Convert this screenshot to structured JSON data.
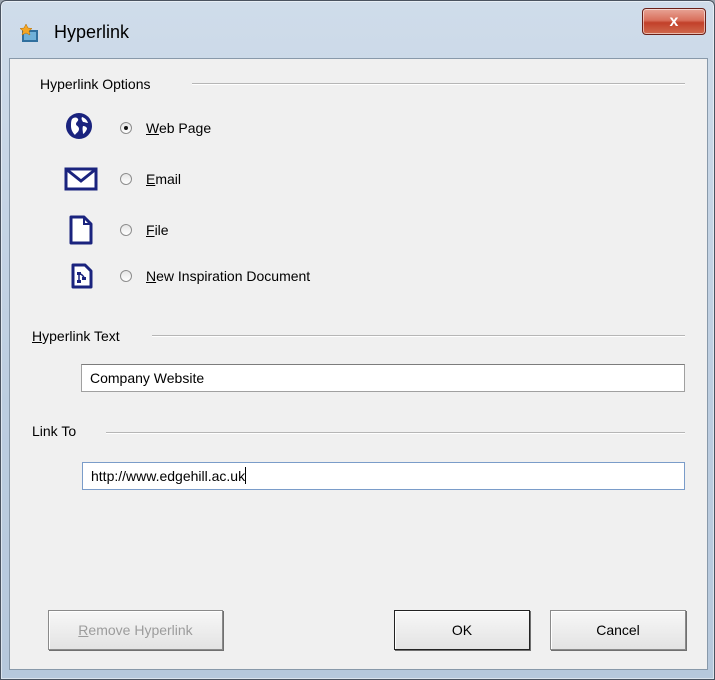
{
  "window": {
    "title": "Hyperlink",
    "close_glyph": "x"
  },
  "options_group": {
    "title": "Hyperlink Options",
    "options": [
      {
        "mnemonic": "W",
        "rest": "eb Page",
        "icon": "globe-icon",
        "checked": true
      },
      {
        "mnemonic": "E",
        "rest": "mail",
        "icon": "envelope-icon",
        "checked": false
      },
      {
        "mnemonic": "F",
        "rest": "ile",
        "icon": "document-icon",
        "checked": false
      },
      {
        "mnemonic": "N",
        "rest": "ew Inspiration Document",
        "icon": "inspiration-document-icon",
        "checked": false
      }
    ]
  },
  "hyperlink_text": {
    "label_mnemonic": "H",
    "label_rest": "yperlink Text",
    "value": "Company Website"
  },
  "link_to": {
    "label": "Link To",
    "value": "http://www.edgehill.ac.uk"
  },
  "buttons": {
    "remove_mnemonic": "R",
    "remove_rest": "emove Hyperlink",
    "ok": "OK",
    "cancel": "Cancel"
  },
  "colors": {
    "icon_blue": "#1a237e",
    "accent_close": "#c2402a",
    "frame": "#bccde0"
  }
}
